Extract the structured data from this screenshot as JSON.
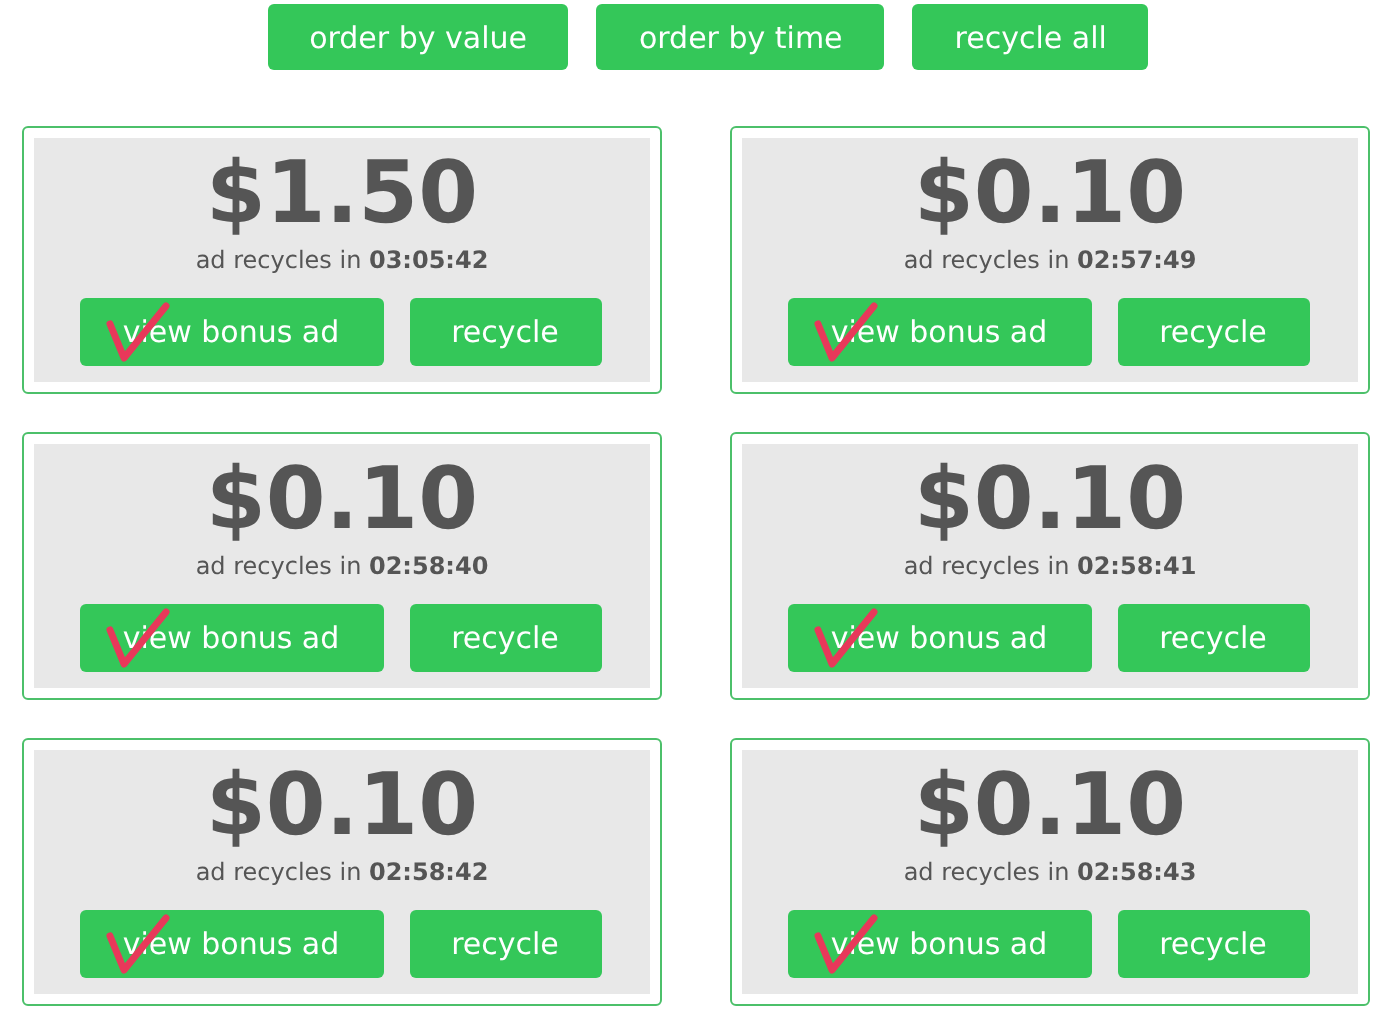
{
  "toolbar": [
    "order by value",
    "order by time",
    "recycle all"
  ],
  "cards": [
    {
      "price": "$1.50",
      "countdown": "ad recycles in **03:05:42**",
      "bonus_button": "view bonus ad",
      "recycle_button": "recycle",
      "ticked": true
    },
    {
      "price": "$0.10",
      "countdown": "ad recycles in **02:57:49**",
      "bonus_button": "view bonus ad",
      "recycle_button": "recycle",
      "ticked": true
    },
    {
      "price": "$0.10",
      "countdown": "ad recycles in **02:58:40**",
      "bonus_button": "view bonus ad",
      "recycle_button": "recycle",
      "ticked": true
    },
    {
      "price": "$0.10",
      "countdown": "ad recycles in **02:58:41**",
      "bonus_button": "view bonus ad",
      "recycle_button": "recycle",
      "ticked": true
    },
    {
      "price": "$0.10",
      "countdown": "ad recycles in **02:58:42**",
      "bonus_button": "view bonus ad",
      "recycle_button": "recycle",
      "ticked": true
    },
    {
      "price": "$0.10",
      "countdown": "ad recycles in **02:58:43**",
      "bonus_button": "view bonus ad",
      "recycle_button": "recycle",
      "ticked": true
    }
  ]
}
